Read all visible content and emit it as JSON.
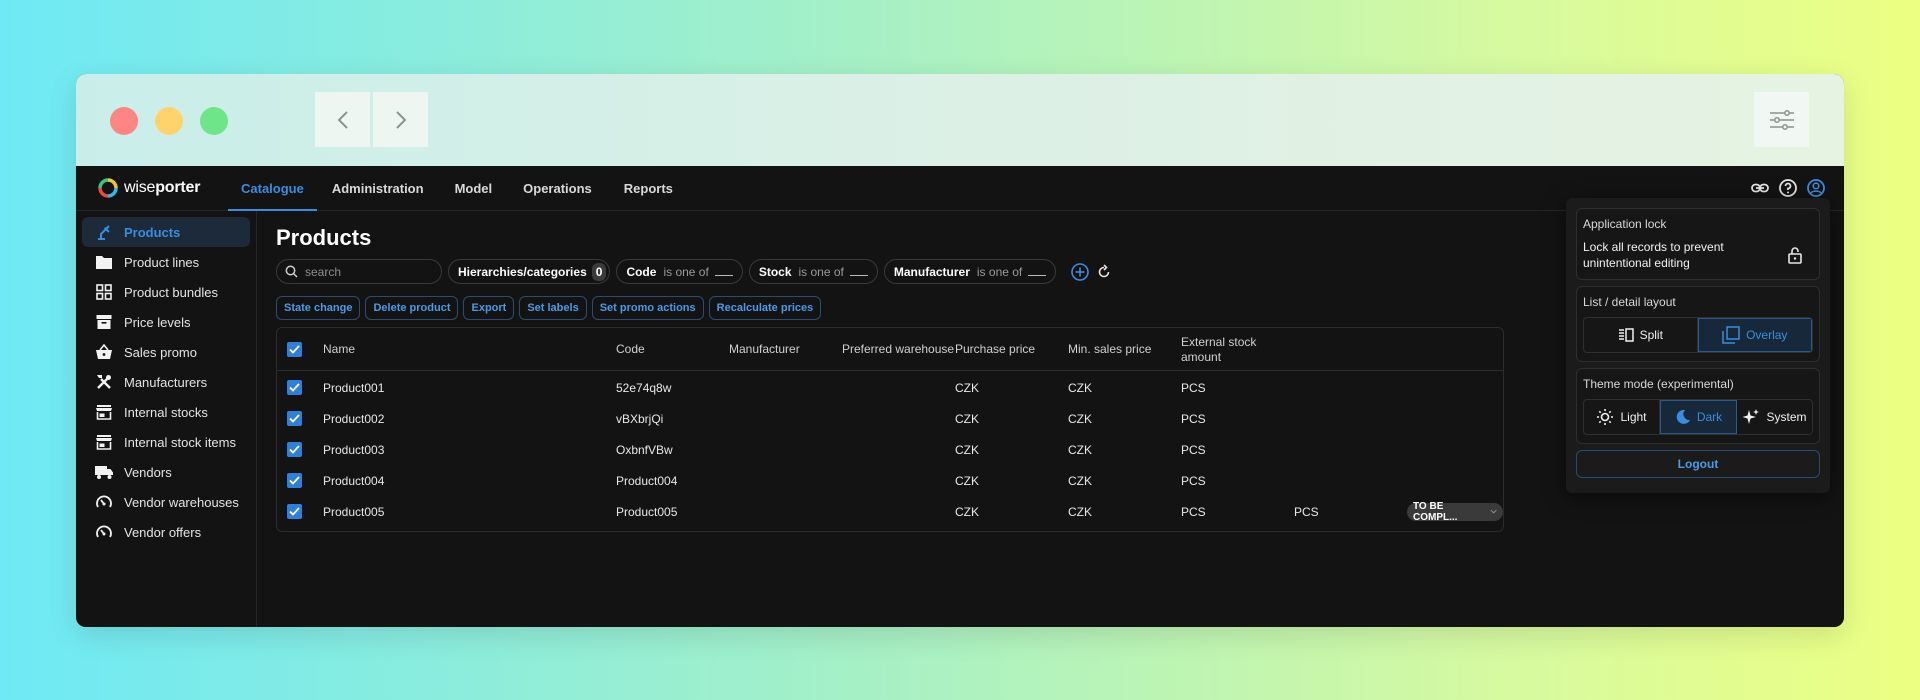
{
  "app": {
    "logo_text_a": "wise",
    "logo_text_b": "porter"
  },
  "nav": {
    "tabs": [
      {
        "label": "Catalogue",
        "active": true
      },
      {
        "label": "Administration"
      },
      {
        "label": "Model"
      },
      {
        "label": "Operations"
      },
      {
        "label": "Reports"
      }
    ]
  },
  "sidebar": {
    "items": [
      {
        "label": "Products",
        "icon": "robot-arm-icon",
        "active": true
      },
      {
        "label": "Product lines",
        "icon": "folder-icon"
      },
      {
        "label": "Product bundles",
        "icon": "grid-icon"
      },
      {
        "label": "Price levels",
        "icon": "archive-icon"
      },
      {
        "label": "Sales promo",
        "icon": "basket-icon"
      },
      {
        "label": "Manufacturers",
        "icon": "tools-icon"
      },
      {
        "label": "Internal stocks",
        "icon": "store-icon"
      },
      {
        "label": "Internal stock items",
        "icon": "store-icon"
      },
      {
        "label": "Vendors",
        "icon": "truck-icon"
      },
      {
        "label": "Vendor warehouses",
        "icon": "speedometer-icon"
      },
      {
        "label": "Vendor offers",
        "icon": "speedometer-icon"
      }
    ]
  },
  "page": {
    "title": "Products"
  },
  "filters": {
    "search_placeholder": "search",
    "hierarchies_label": "Hierarchies/categories",
    "hierarchies_count": "0",
    "code_label": "Code",
    "stock_label": "Stock",
    "manufacturer_label": "Manufacturer",
    "op_text": "is one of"
  },
  "actions": [
    "State change",
    "Delete product",
    "Export",
    "Set labels",
    "Set promo actions",
    "Recalculate prices"
  ],
  "table": {
    "columns": [
      "Name",
      "Code",
      "Manufacturer",
      "Preferred warehouse",
      "Purchase price",
      "Min. sales price",
      "External stock amount"
    ],
    "rows": [
      {
        "name": "Product001",
        "code": "52e74q8w",
        "purchase": "CZK",
        "minsales": "CZK",
        "stock": "PCS"
      },
      {
        "name": "Product002",
        "code": "vBXbrjQi",
        "purchase": "CZK",
        "minsales": "CZK",
        "stock": "PCS"
      },
      {
        "name": "Product003",
        "code": "OxbnfVBw",
        "purchase": "CZK",
        "minsales": "CZK",
        "stock": "PCS"
      },
      {
        "name": "Product004",
        "code": "Product004",
        "purchase": "CZK",
        "minsales": "CZK",
        "stock": "PCS"
      },
      {
        "name": "Product005",
        "code": "Product005",
        "purchase": "CZK",
        "minsales": "CZK",
        "stock": "PCS",
        "extra_unit": "PCS",
        "status": "TO BE COMPL..."
      }
    ]
  },
  "popover": {
    "lock_title": "Application lock",
    "lock_text": "Lock all records to prevent unintentional editing",
    "layout_title": "List / detail layout",
    "layout_options": [
      {
        "label": "Split"
      },
      {
        "label": "Overlay",
        "active": true
      }
    ],
    "theme_title": "Theme mode (experimental)",
    "theme_options": [
      {
        "label": "Light"
      },
      {
        "label": "Dark",
        "active": true
      },
      {
        "label": "System"
      }
    ],
    "logout_label": "Logout"
  },
  "colors": {
    "accent": "#3a8dde",
    "bg": "#131313",
    "checkbox": "#2f80d8"
  }
}
